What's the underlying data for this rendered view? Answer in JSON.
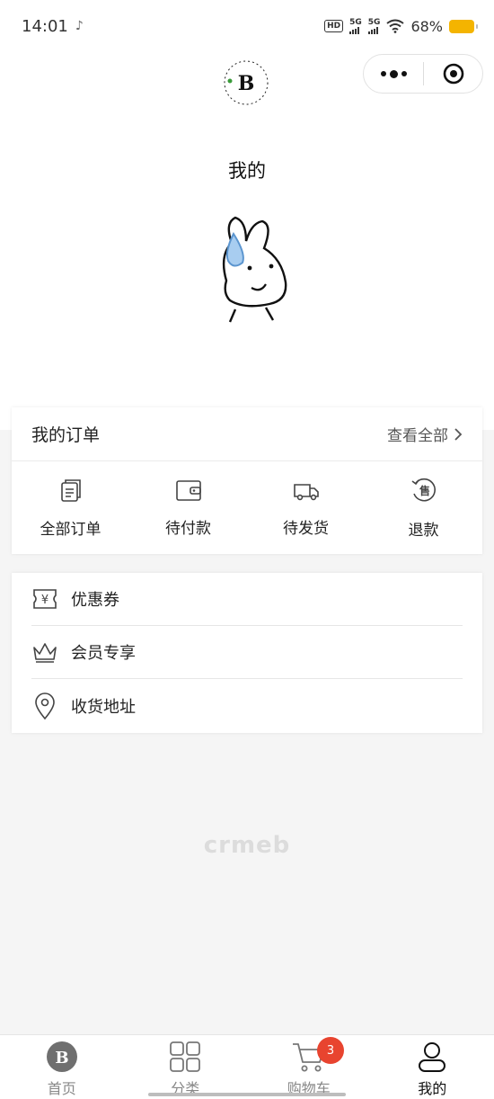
{
  "status_bar": {
    "time": "14:01",
    "network_1": "5G",
    "network_2": "5G",
    "hd": "HD",
    "battery": "68%"
  },
  "header": {
    "page_title": "我的",
    "logo_mark": "B"
  },
  "orders": {
    "title": "我的订单",
    "view_all": "查看全部",
    "items": [
      {
        "label": "全部订单",
        "icon": "document-icon"
      },
      {
        "label": "待付款",
        "icon": "wallet-icon"
      },
      {
        "label": "待发货",
        "icon": "truck-icon"
      },
      {
        "label": "退款",
        "icon": "refund-icon",
        "icon_text": "售"
      }
    ]
  },
  "menu": {
    "items": [
      {
        "label": "优惠券",
        "icon": "coupon-icon",
        "icon_text": "¥"
      },
      {
        "label": "会员专享",
        "icon": "crown-icon"
      },
      {
        "label": "收货地址",
        "icon": "location-icon"
      }
    ]
  },
  "watermark": "crmeb",
  "tabbar": {
    "items": [
      {
        "label": "首页",
        "icon": "home-logo-icon"
      },
      {
        "label": "分类",
        "icon": "grid-icon"
      },
      {
        "label": "购物车",
        "icon": "cart-icon",
        "badge": "3"
      },
      {
        "label": "我的",
        "icon": "user-icon",
        "active": true
      }
    ]
  },
  "colors": {
    "badge": "#e8442f",
    "battery": "#f4b400",
    "background": "#f5f5f5"
  }
}
